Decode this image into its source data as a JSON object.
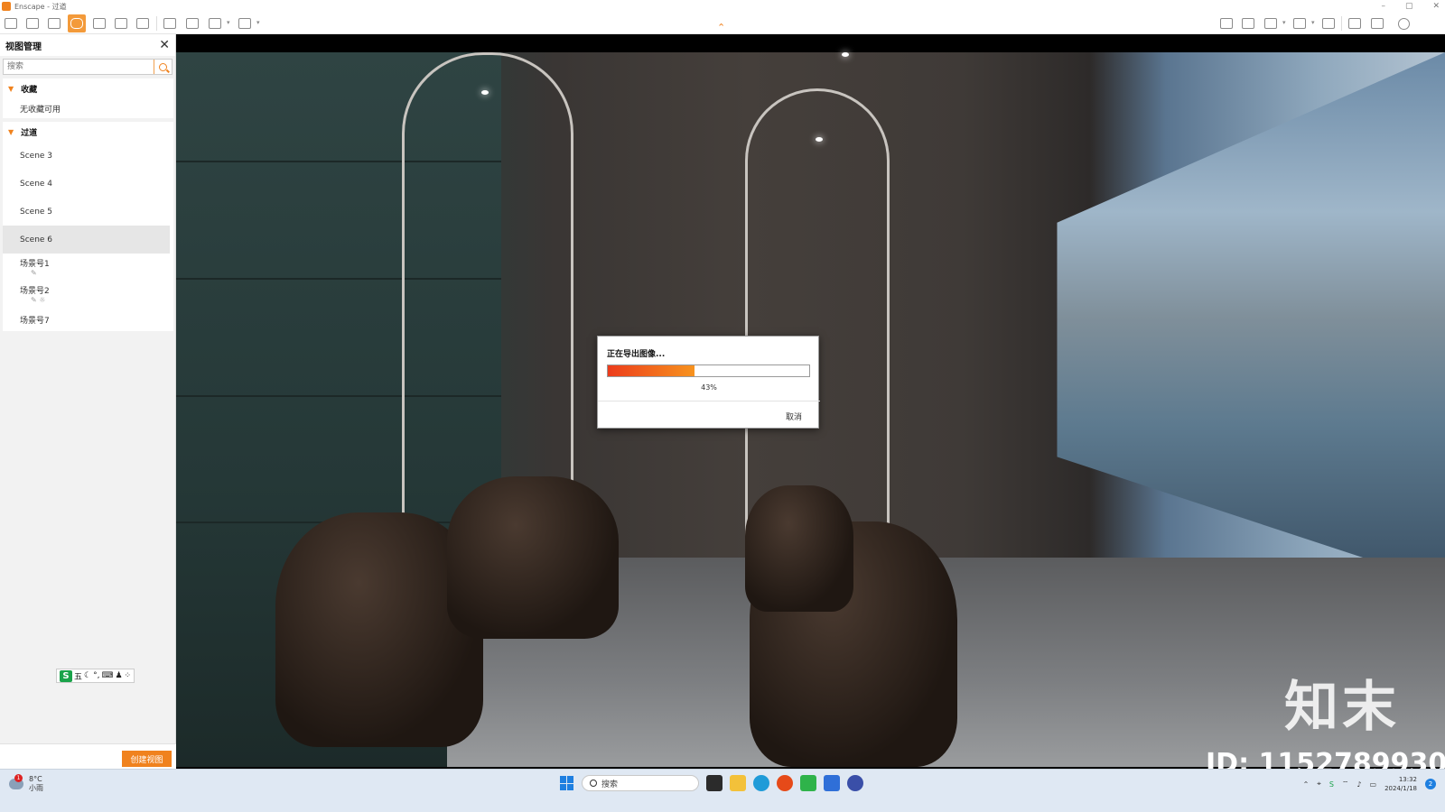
{
  "window": {
    "title": "Enscape - 过道"
  },
  "dialog": {
    "title": "正在导出图像...",
    "progress": 0.43,
    "progress_label": "43%",
    "cancel_label": "取消"
  },
  "sidebar": {
    "title": "视图管理",
    "search_placeholder": "搜索",
    "favorites": {
      "label": "收藏",
      "empty_text": "无收藏可用"
    },
    "views": {
      "label": "过道",
      "items": [
        {
          "label": "Scene 3"
        },
        {
          "label": "Scene 4"
        },
        {
          "label": "Scene 5"
        },
        {
          "label": "Scene 6",
          "selected": true
        },
        {
          "label": "场景号1"
        },
        {
          "label": "场景号2"
        },
        {
          "label": "场景号7"
        }
      ]
    },
    "ime": {
      "logo": "S",
      "mode": "五"
    },
    "create_button": "创建视图"
  },
  "viewport": {
    "watermark": "知末",
    "watermark_id": "ID: 1152789930"
  },
  "taskbar": {
    "weather": {
      "temp": "8°C",
      "desc": "小雨",
      "badge": "1"
    },
    "search_placeholder": "搜索",
    "clock": {
      "time": "13:32",
      "date": "2024/1/18"
    },
    "notification_count": "2"
  },
  "colors": {
    "accent": "#f0821e",
    "progress_start": "#ec3c1c",
    "progress_end": "#f7931e"
  }
}
